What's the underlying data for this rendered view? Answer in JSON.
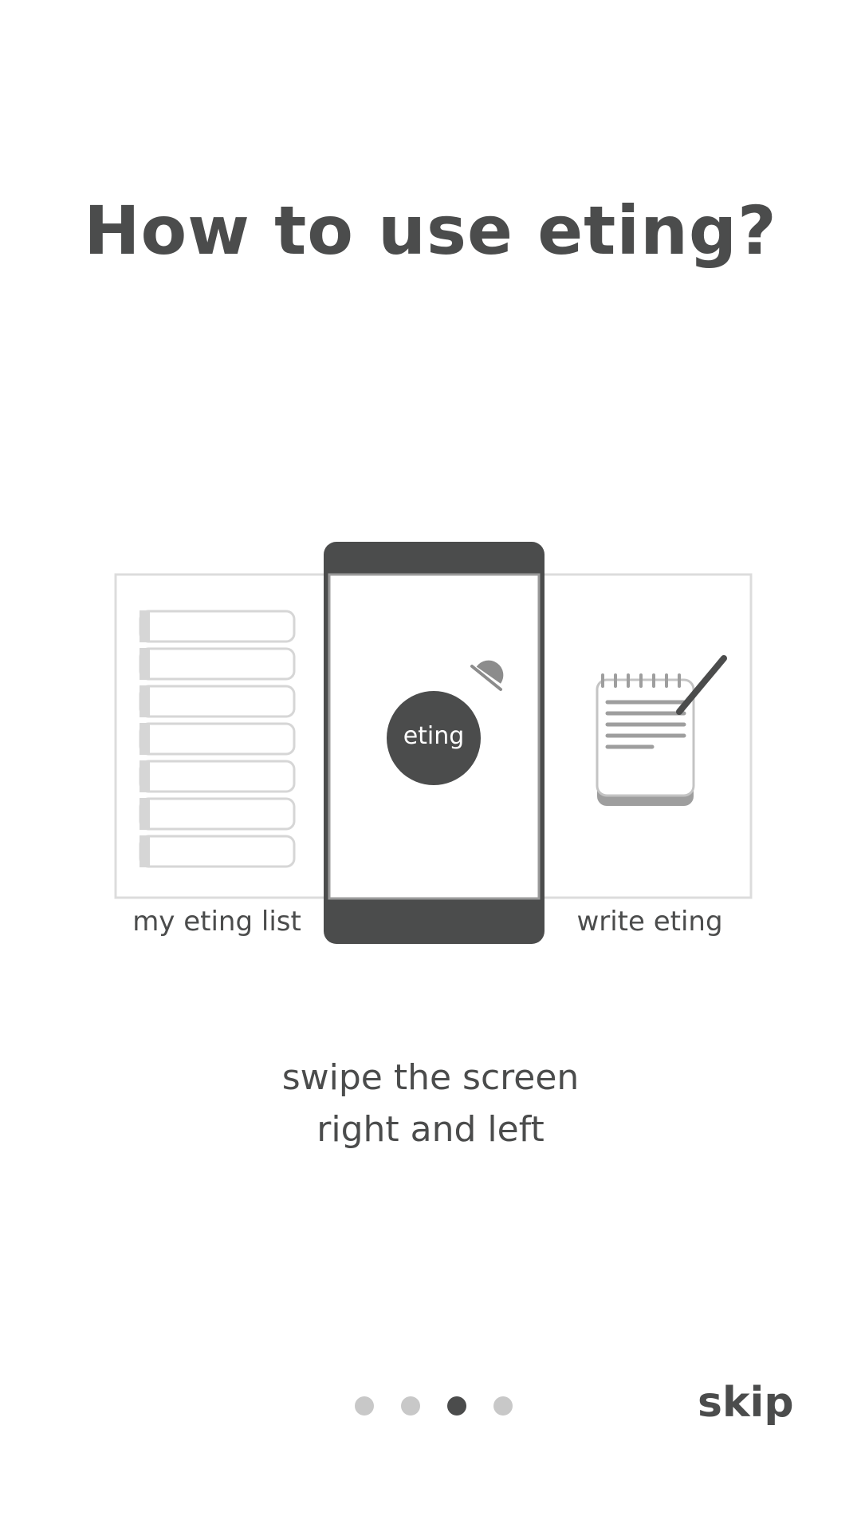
{
  "header": {
    "title": "How to use eting?"
  },
  "illustration": {
    "phone_button_label": "eting",
    "left_label": "my eting list",
    "right_label": "write eting",
    "icons": [
      "list-icon",
      "phone-icon",
      "eting-button-icon",
      "ufo-icon",
      "notepad-icon",
      "pen-icon"
    ]
  },
  "instruction": {
    "line1": "swipe the screen",
    "line2": "right and left"
  },
  "pager": {
    "dots": [
      "page 1",
      "page 2",
      "page 3",
      "page 4"
    ],
    "active_index": 2
  },
  "skip_label": "skip",
  "colors": {
    "dark": "#4b4c4c",
    "light_gray": "#d9d9d9",
    "mid_gray": "#9e9e9e",
    "inactive_dot": "#c8c8c8",
    "background": "#ffffff"
  }
}
